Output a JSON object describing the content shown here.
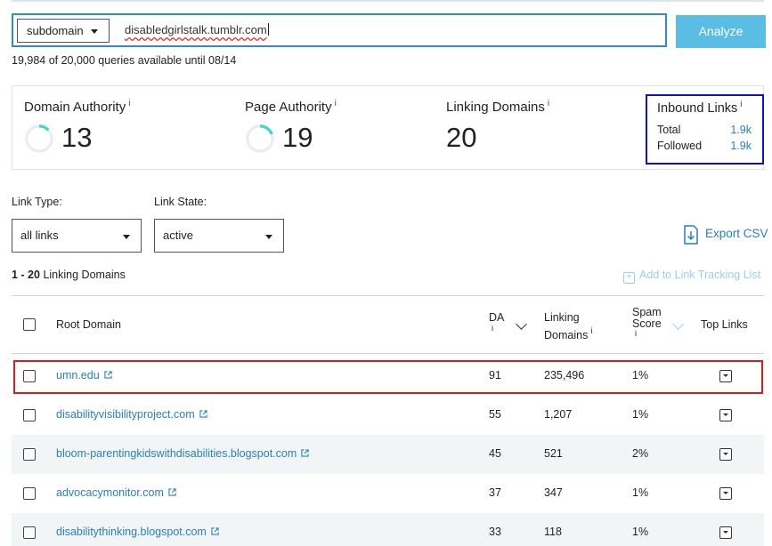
{
  "search": {
    "scope": "subdomain",
    "query": "disabledgirlstalk.tumblr.com",
    "analyze_label": "Analyze",
    "quota_text": "19,984 of 20,000 queries available until 08/14"
  },
  "metrics": {
    "domain_authority": {
      "label": "Domain Authority",
      "value": "13",
      "level": 13
    },
    "page_authority": {
      "label": "Page Authority",
      "value": "19",
      "level": 19
    },
    "linking_domains": {
      "label": "Linking Domains",
      "value": "20"
    },
    "inbound_links": {
      "label": "Inbound Links",
      "total_label": "Total",
      "total_value": "1.9k",
      "followed_label": "Followed",
      "followed_value": "1.9k"
    },
    "info_glyph": "i"
  },
  "filters": {
    "link_type_label": "Link Type:",
    "link_type_value": "all links",
    "link_state_label": "Link State:",
    "link_state_value": "active",
    "export_label": "Export CSV"
  },
  "results": {
    "count_range": "1 - 20",
    "count_suffix": "Linking Domains",
    "track_label": "Add to Link Tracking List"
  },
  "table": {
    "headers": {
      "root_domain": "Root Domain",
      "da": "DA",
      "linking_domains_line1": "Linking",
      "linking_domains_line2": "Domains",
      "spam_line1": "Spam",
      "spam_line2": "Score",
      "top_links": "Top Links"
    },
    "rows": [
      {
        "domain": "umn.edu",
        "da": "91",
        "linking_domains": "235,496",
        "spam": "1%"
      },
      {
        "domain": "disabilityvisibilityproject.com",
        "da": "55",
        "linking_domains": "1,207",
        "spam": "1%"
      },
      {
        "domain": "bloom-parentingkidswithdisabilities.blogspot.com",
        "da": "45",
        "linking_domains": "521",
        "spam": "2%"
      },
      {
        "domain": "advocacymonitor.com",
        "da": "37",
        "linking_domains": "347",
        "spam": "1%"
      },
      {
        "domain": "disabilitythinking.blogspot.com",
        "da": "33",
        "linking_domains": "118",
        "spam": "1%"
      }
    ]
  },
  "colors": {
    "accent": "#2a7fb5",
    "analyze_button": "#5bbde4",
    "gauge": "#4fd1c5",
    "highlight_red": "#d81a1a",
    "highlight_blue": "#1212b8"
  }
}
